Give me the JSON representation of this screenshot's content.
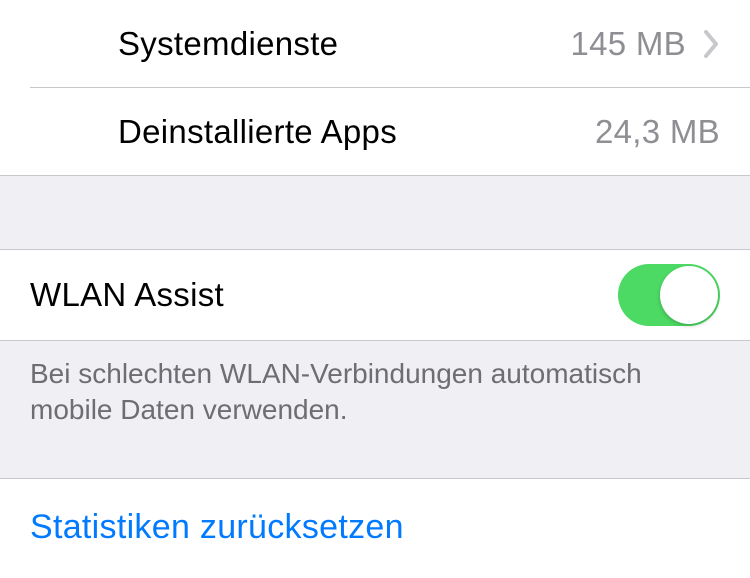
{
  "usage": {
    "system_services": {
      "label": "Systemdienste",
      "value": "145 MB"
    },
    "uninstalled_apps": {
      "label": "Deinstallierte Apps",
      "value": "24,3 MB"
    }
  },
  "wlan_assist": {
    "label": "WLAN Assist",
    "enabled": true,
    "description": "Bei schlechten WLAN-Verbindungen automatisch mobile Daten verwenden."
  },
  "reset": {
    "label": "Statistiken zurücksetzen"
  }
}
